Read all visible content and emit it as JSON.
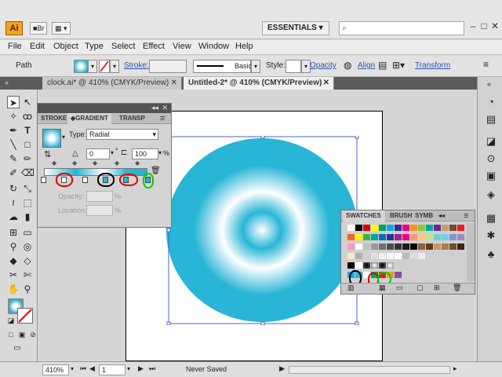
{
  "app": {
    "logo": "Ai",
    "bridge_label": "Br",
    "workspace": "ESSENTIALS",
    "search_placeholder": ""
  },
  "menu": [
    "File",
    "Edit",
    "Object",
    "Type",
    "Select",
    "Effect",
    "View",
    "Window",
    "Help"
  ],
  "control": {
    "object_type": "Path",
    "stroke_label": "Stroke:",
    "stroke_profile": "Basic",
    "style_label": "Style:",
    "opacity_link": "Opacity",
    "align_link": "Align",
    "transform_link": "Transform"
  },
  "tabs": [
    {
      "label": "clock.ai* @ 410% (CMYK/Preview)"
    },
    {
      "label": "Untitled-2* @ 410% (CMYK/Preview)"
    }
  ],
  "gradient_panel": {
    "tab_stroke": "STROKE",
    "tab_gradient": "GRADIENT",
    "tab_transparency": "TRANSP",
    "type_label": "Type:",
    "type_value": "Radial",
    "angle_value": "0",
    "aspect_value": "100",
    "percent_sign": "%",
    "degree_sign": "°",
    "opacity_label": "Opacity:",
    "location_label": "Location:"
  },
  "swatches_panel": {
    "tab_swatches": "SWATCHES",
    "tab_brushes": "BRUSH",
    "tab_symbols": "SYMB"
  },
  "status": {
    "zoom": "410%",
    "page": "1",
    "save_state": "Never Saved"
  },
  "colors": {
    "accent_cyan": "#28b5d6",
    "highlight_red": "#e00000",
    "highlight_black": "#000000",
    "highlight_green": "#00cc00"
  }
}
